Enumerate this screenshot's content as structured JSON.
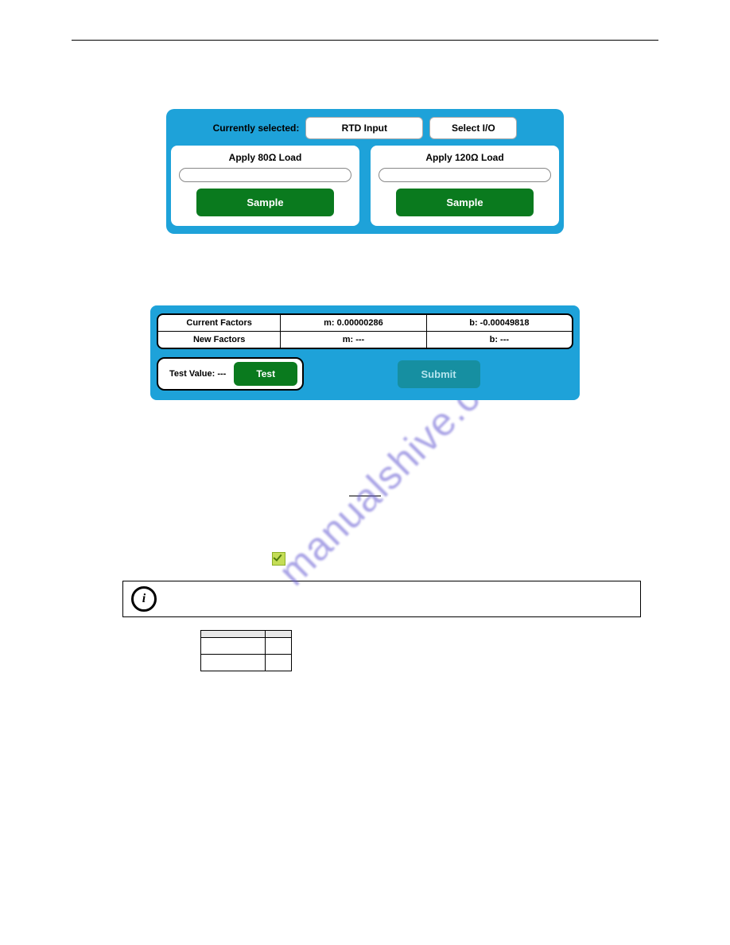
{
  "watermark": "manualshive.com",
  "ui1": {
    "currently_selected_label": "Currently selected:",
    "rtd_value": "RTD Input",
    "select_io_label": "Select I/O",
    "card_left_title": "Apply 80Ω Load",
    "card_right_title": "Apply 120Ω Load",
    "sample_label": "Sample"
  },
  "ui2": {
    "header": {
      "c1": "Current Factors",
      "c2": "m: 0.00000286",
      "c3": "b: -0.00049818"
    },
    "new": {
      "c1": "New Factors",
      "c2": "m: ---",
      "c3": "b: ---"
    },
    "test_value_label": "Test Value: ---",
    "test_btn": "Test",
    "submit_btn": "Submit"
  },
  "table": {
    "th1": "",
    "th2": "",
    "r1c1": "",
    "r1c2": "",
    "r2c1": "",
    "r2c2": ""
  },
  "info_text": ""
}
